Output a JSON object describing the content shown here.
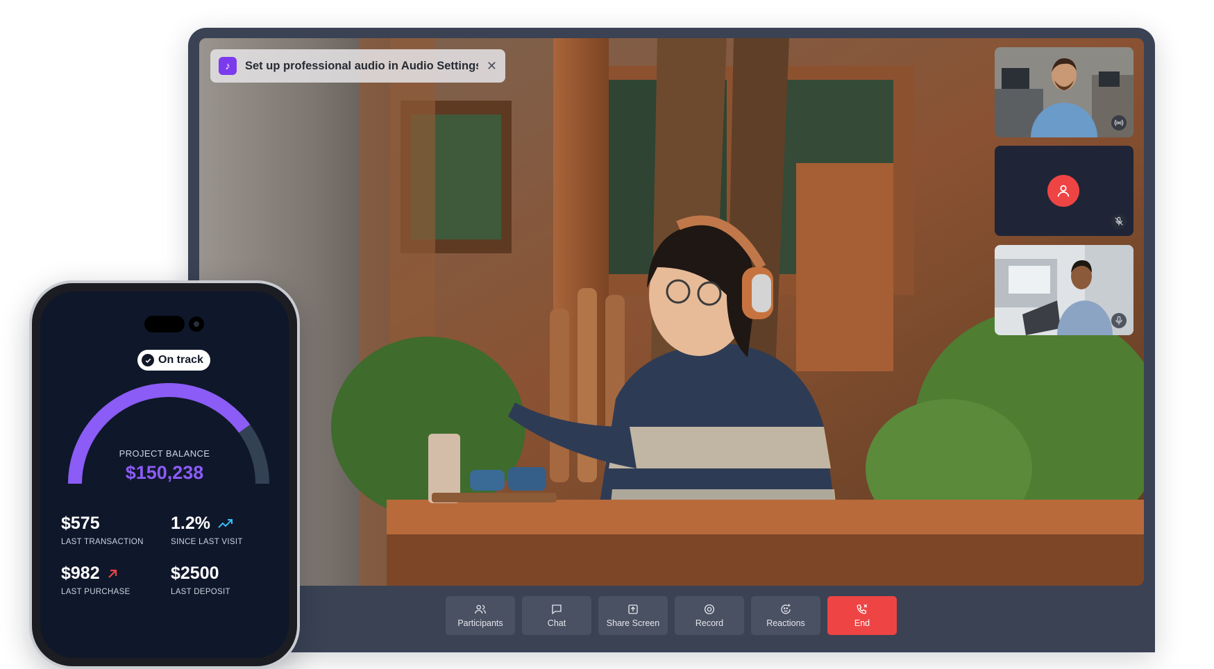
{
  "toast": {
    "icon": "music-note-icon",
    "message": "Set up professional audio in Audio Settings",
    "close": "close-icon"
  },
  "participants": [
    {
      "type": "video",
      "indicator": "broadcast-icon"
    },
    {
      "type": "avatar",
      "indicator": "microphone-off-icon"
    },
    {
      "type": "video",
      "indicator": "microphone-icon"
    }
  ],
  "controls": [
    {
      "label": "Participants",
      "icon": "users-icon"
    },
    {
      "label": "Chat",
      "icon": "chat-icon"
    },
    {
      "label": "Share Screen",
      "icon": "share-screen-icon"
    },
    {
      "label": "Record",
      "icon": "record-icon"
    },
    {
      "label": "Reactions",
      "icon": "reactions-icon"
    },
    {
      "label": "End",
      "icon": "phone-hangup-icon"
    }
  ],
  "colors": {
    "accent": "#8b5cf6",
    "end": "#ef4444",
    "frame": "#3a4254",
    "phone_bg": "#0f172a"
  },
  "phone": {
    "badge": "On track",
    "balance_label": "PROJECT BALANCE",
    "balance_value": "$150,238",
    "progress": 0.8,
    "stats": [
      {
        "value": "$575",
        "label": "LAST TRANSACTION"
      },
      {
        "value": "1.2%",
        "label": "SINCE LAST VISIT",
        "trend_icon": "trending-up-icon"
      },
      {
        "value": "$982",
        "label": "LAST PURCHASE",
        "trend_icon": "arrow-up-right-icon"
      },
      {
        "value": "$2500",
        "label": "LAST DEPOSIT"
      }
    ]
  }
}
